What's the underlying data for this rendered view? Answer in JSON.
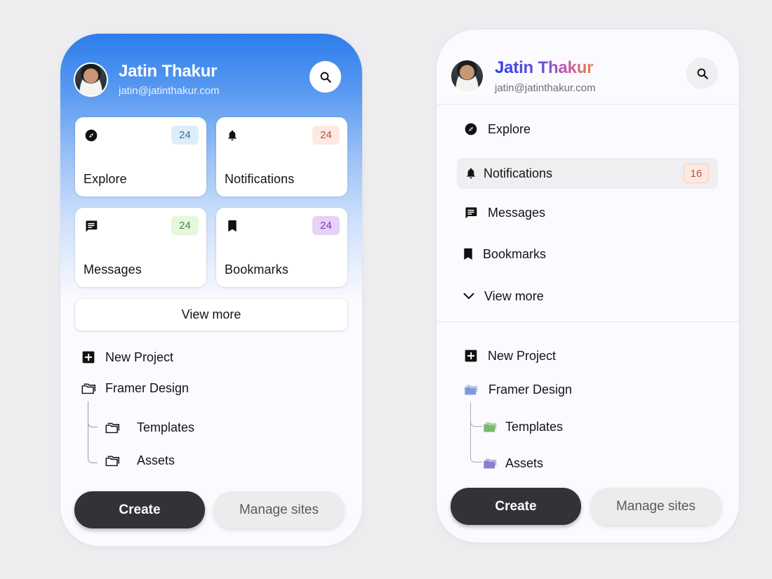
{
  "left": {
    "profile": {
      "name": "Jatin Thakur",
      "email": "jatin@jatinthakur.com"
    },
    "tiles": [
      {
        "label": "Explore",
        "count": "24",
        "icon": "compass-icon",
        "badge_bg": "#ddeefb",
        "badge_fg": "#3a6f95"
      },
      {
        "label": "Notifications",
        "count": "24",
        "icon": "bell-icon",
        "badge_bg": "#fde9e1",
        "badge_fg": "#b5573a"
      },
      {
        "label": "Messages",
        "count": "24",
        "icon": "message-icon",
        "badge_bg": "#e5f7dc",
        "badge_fg": "#4f8a3a"
      },
      {
        "label": "Bookmarks",
        "count": "24",
        "icon": "bookmark-icon",
        "badge_bg": "#e5d2f6",
        "badge_fg": "#7a3fae"
      }
    ],
    "view_more": "View more",
    "tree": {
      "new_project": "New Project",
      "folder": "Framer Design",
      "children": [
        "Templates",
        "Assets"
      ]
    },
    "create": "Create",
    "manage": "Manage sites"
  },
  "right": {
    "profile": {
      "name": "Jatin Thakur",
      "email": "jatin@jatinthakur.com"
    },
    "nav": [
      {
        "label": "Explore",
        "icon": "compass-icon"
      },
      {
        "label": "Notifications",
        "icon": "bell-icon",
        "count": "16",
        "active": true
      },
      {
        "label": "Messages",
        "icon": "message-icon"
      },
      {
        "label": "Bookmarks",
        "icon": "bookmark-icon"
      },
      {
        "label": "View more",
        "icon": "chevron-down-icon"
      }
    ],
    "tree": {
      "new_project": "New Project",
      "folder": "Framer Design",
      "children": [
        "Templates",
        "Assets"
      ]
    },
    "create": "Create",
    "manage": "Manage sites"
  },
  "colors": {
    "brand_blue": "#2c7deb",
    "button_dark": "#333236",
    "folder_blue": "#7f9ad8",
    "folder_green": "#7ab86b",
    "folder_purple": "#8a7fcc",
    "notif_badge_bg": "#fde9e1",
    "notif_badge_fg": "#b5573a"
  }
}
